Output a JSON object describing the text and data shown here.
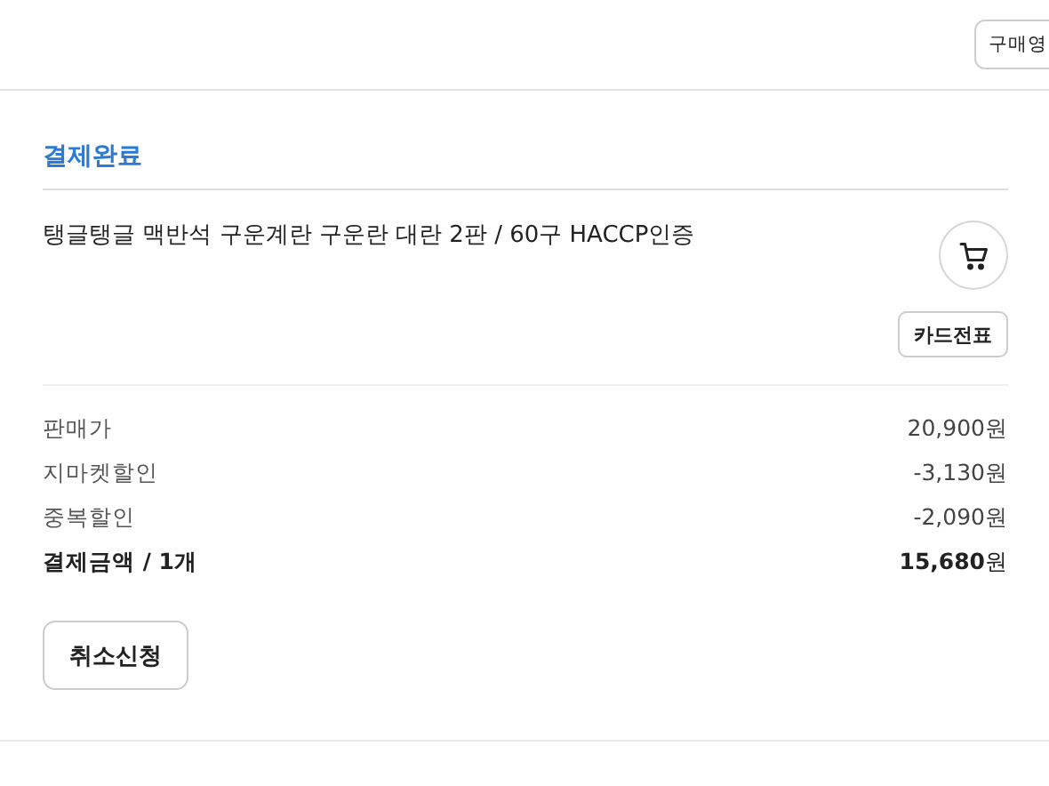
{
  "top_bar": {
    "button": "구매영"
  },
  "order": {
    "status": "결제완료",
    "product": "탱글탱글 맥반석 구운계란 구운란 대란 2판 / 60구 HACCP인증",
    "card_receipt_button": "카드전표",
    "price_rows": [
      {
        "label": "판매가",
        "amount": "20,900원",
        "kind": "normal"
      },
      {
        "label": "지마켓할인",
        "amount": "-3,130원",
        "kind": "normal"
      },
      {
        "label": "중복할인",
        "amount": "-2,090원",
        "kind": "normal"
      },
      {
        "label": "결제금액 / 1개",
        "amount": "**15,680**원",
        "kind": "total"
      }
    ],
    "cancel_button": "취소신청"
  }
}
